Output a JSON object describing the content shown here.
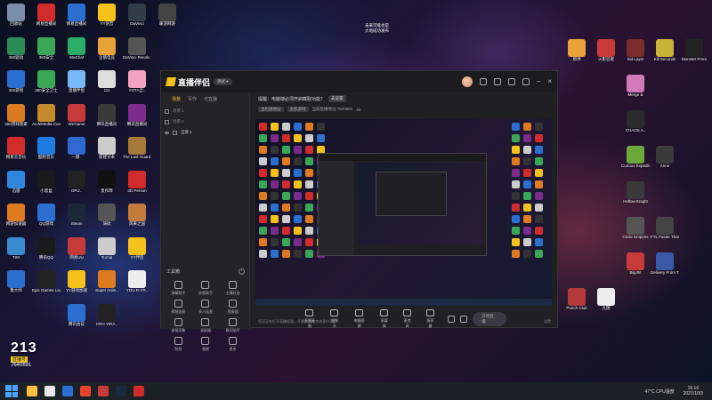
{
  "desktop": {
    "left_icons": [
      {
        "label": "回收站",
        "color": "#7a8ea8"
      },
      {
        "label": "网易直播间",
        "color": "#d12b2b"
      },
      {
        "label": "网易直播间",
        "color": "#2b6fd1"
      },
      {
        "label": "YY语音",
        "color": "#f4c21b"
      },
      {
        "label": "DaVinci",
        "color": "#333a48"
      },
      {
        "label": "暖游网游",
        "color": "#444"
      },
      {
        "label": "360驱动",
        "color": "#2e8b57"
      },
      {
        "label": "360安全",
        "color": "#3aa757"
      },
      {
        "label": "WeChat",
        "color": "#2aae67"
      },
      {
        "label": "企鹅电竞",
        "color": "#e8a23a"
      },
      {
        "label": "DaVinci Resolv...",
        "color": "#555"
      },
      {
        "label": "",
        "color": "#000"
      },
      {
        "label": "360游戏",
        "color": "#2b6fd1"
      },
      {
        "label": "360安全卫士",
        "color": "#3aa757"
      },
      {
        "label": "直播伴侣",
        "color": "#7ab8f5"
      },
      {
        "label": "111",
        "color": "#ddd"
      },
      {
        "label": "YOTA全..",
        "color": "#f2a3c0"
      },
      {
        "label": "",
        "color": "#000"
      },
      {
        "label": "360游戏管家",
        "color": "#d97a1e"
      },
      {
        "label": "ArchiMedia Controll",
        "color": "#c58a2c"
      },
      {
        "label": "WeGame",
        "color": "#c63a3a"
      },
      {
        "label": "腾讯直播间",
        "color": "#3a3a3a"
      },
      {
        "label": "腾讯直播间",
        "color": "#7c2c8c"
      },
      {
        "label": "",
        "color": "#000"
      },
      {
        "label": "网易云音乐",
        "color": "#d12b2b"
      },
      {
        "label": "酷狗音乐",
        "color": "#1e7be0"
      },
      {
        "label": "一键..",
        "color": "#2e6ad1"
      },
      {
        "label": "新建文本",
        "color": "#ccc"
      },
      {
        "label": "The Last Guard..",
        "color": "#a87a3a"
      },
      {
        "label": "",
        "color": "#000"
      },
      {
        "label": "迅雷",
        "color": "#2e86de"
      },
      {
        "label": "小黑盒",
        "color": "#1a1a1a"
      },
      {
        "label": "GPU..",
        "color": "#222"
      },
      {
        "label": "反作弊",
        "color": "#111"
      },
      {
        "label": "3D Person",
        "color": "#d12b2b"
      },
      {
        "label": "",
        "color": "#000"
      },
      {
        "label": "网游加速器",
        "color": "#e07a1e"
      },
      {
        "label": "QQ游戏",
        "color": "#2b6fd1"
      },
      {
        "label": "Steam",
        "color": "#1b2838"
      },
      {
        "label": "骑砍",
        "color": "#555"
      },
      {
        "label": "风来之国",
        "color": "#c27b3a"
      },
      {
        "label": "",
        "color": "#000"
      },
      {
        "label": "TIM",
        "color": "#3a8ad1"
      },
      {
        "label": "腾讯QQ",
        "color": "#1a1a1a"
      },
      {
        "label": "网易UU",
        "color": "#c63a3a"
      },
      {
        "label": "Turnip",
        "color": "#ccc"
      },
      {
        "label": "YY伴侣",
        "color": "#f4c21b"
      },
      {
        "label": "",
        "color": "#000"
      },
      {
        "label": "鲁大师",
        "color": "#2b6fd1"
      },
      {
        "label": "Epic Games Launcher",
        "color": "#222"
      },
      {
        "label": "YY游戏加速",
        "color": "#f4c21b"
      },
      {
        "label": "Super Anim..",
        "color": "#e07a1e"
      },
      {
        "label": "YOU R-YR..",
        "color": "#eee"
      },
      {
        "label": "",
        "color": "#000"
      },
      {
        "label": "",
        "color": "#000"
      },
      {
        "label": "",
        "color": "#000"
      },
      {
        "label": "腾讯会议",
        "color": "#2b6fd1"
      },
      {
        "label": "KRH YIRA..",
        "color": "#222"
      },
      {
        "label": "",
        "color": "#000"
      },
      {
        "label": "",
        "color": "#000"
      }
    ],
    "right_icons": [
      {
        "label": "原神",
        "color": "#e8a23a"
      },
      {
        "label": "火影忍者",
        "color": "#c63a3a"
      },
      {
        "label": "Sid Layer",
        "color": "#7a2c2c"
      },
      {
        "label": "Kill Seconds",
        "color": "#c9b23a"
      },
      {
        "label": "Monster Prom",
        "color": "#222"
      },
      {
        "label": "",
        "color": "#000"
      },
      {
        "label": "",
        "color": "#000"
      },
      {
        "label": "Merge &",
        "color": "#d17ab8"
      },
      {
        "label": "",
        "color": "#000"
      },
      {
        "label": "",
        "color": "#000"
      },
      {
        "label": "",
        "color": "#000"
      },
      {
        "label": "",
        "color": "#000"
      },
      {
        "label": "CHAOS A..",
        "color": "#2a2a2a"
      },
      {
        "label": "",
        "color": "#000"
      },
      {
        "label": "",
        "color": "#000"
      },
      {
        "label": "",
        "color": "#000"
      },
      {
        "label": "",
        "color": "#000"
      },
      {
        "label": "Curious Expedition",
        "color": "#6aa83a"
      },
      {
        "label": "Anne",
        "color": "#3a3a3a"
      },
      {
        "label": "",
        "color": "#000"
      },
      {
        "label": "",
        "color": "#000"
      },
      {
        "label": "",
        "color": "#000"
      },
      {
        "label": "Hollow Knight",
        "color": "#3a3a3a"
      },
      {
        "label": "",
        "color": "#000"
      },
      {
        "label": "",
        "color": "#000"
      },
      {
        "label": "",
        "color": "#000"
      },
      {
        "label": "",
        "color": "#000"
      },
      {
        "label": "Circle Empires",
        "color": "#555"
      },
      {
        "label": "FTL Faster Than Light",
        "color": "#444"
      },
      {
        "label": "",
        "color": "#000"
      },
      {
        "label": "",
        "color": "#000"
      },
      {
        "label": "",
        "color": "#000"
      },
      {
        "label": "Big Bit",
        "color": "#c63a3a"
      },
      {
        "label": "Delivery From T..",
        "color": "#3a5aa8"
      },
      {
        "label": "",
        "color": "#000"
      },
      {
        "label": "Punch Club",
        "color": "#b53a3a"
      },
      {
        "label": "九阴",
        "color": "#eee"
      },
      {
        "label": "",
        "color": "#000"
      },
      {
        "label": "",
        "color": "#000"
      },
      {
        "label": "",
        "color": "#000"
      }
    ],
    "center_text_1": "未来可能也是",
    "center_text_2": "大地成功发布"
  },
  "app": {
    "name": "直播伴侣",
    "version": "测试 ▾",
    "tabs": [
      "场景",
      "写作",
      "可直播"
    ],
    "scenes": [
      "场景 1",
      "场景 2",
      "全屏 1"
    ],
    "tools_title": "工具箱",
    "tools": [
      {
        "label": "弹幕助手"
      },
      {
        "label": "房管助手"
      },
      {
        "label": "主播任务"
      },
      {
        "label": "视频连麦"
      },
      {
        "label": "多人连麦"
      },
      {
        "label": "投屏器"
      },
      {
        "label": "虚拟形象"
      },
      {
        "label": "录屏器"
      },
      {
        "label": "歌词助手"
      },
      {
        "label": "贴纸"
      },
      {
        "label": "美颜"
      },
      {
        "label": "更多"
      }
    ],
    "notice": "提醒：电脑端必须开启截取功能？",
    "notice_btn": "去设置",
    "status_chip_1": "主机源地址",
    "status_chip_2": "主机源地",
    "status_text": "当前直播地址 7640691",
    "status_count": "48",
    "controls": [
      {
        "label": "直播画面"
      },
      {
        "label": "摄像头"
      },
      {
        "label": "电脑投屏"
      },
      {
        "label": "多媒体"
      },
      {
        "label": "麦克风"
      },
      {
        "label": "扬声器"
      }
    ],
    "start_btn": "开始直播",
    "bottom_msg": "您还没有打开直播权限，开播前请先完成身份认证",
    "bottom_right": "设置"
  },
  "room": {
    "big": "213",
    "tag": "直播号",
    "num": "7640691"
  },
  "taskbar": {
    "apps": [
      "#ffbf3f",
      "#e8e8e8",
      "#2b6fd1",
      "#e8442d",
      "#c63a3a",
      "#1b2838",
      "#d12b2b"
    ],
    "weather": "47°C CPU温度",
    "time": "15:16",
    "date": "2021/10/3"
  }
}
